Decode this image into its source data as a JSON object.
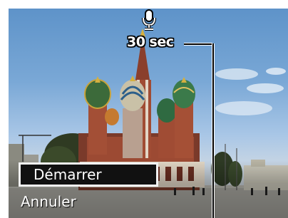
{
  "screen": {
    "status": {
      "icon": "microphone-icon",
      "remaining_time": "30 sec"
    },
    "menu": {
      "items": [
        {
          "label": "Démarrer",
          "selected": true
        },
        {
          "label": "Annuler",
          "selected": false
        }
      ]
    }
  },
  "colors": {
    "menu_selected_bg": "#111111",
    "menu_selected_border": "#f2f2f2",
    "text": "#ffffff"
  }
}
